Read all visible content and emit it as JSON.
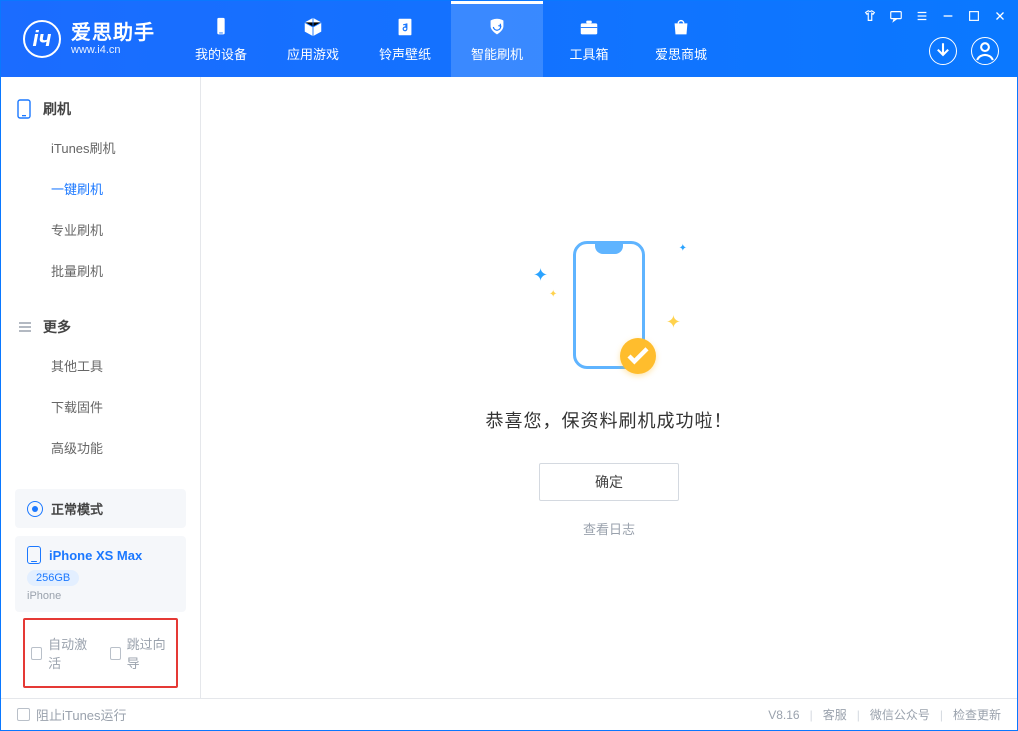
{
  "logo": {
    "cn": "爱思助手",
    "en": "www.i4.cn"
  },
  "nav": {
    "items": [
      {
        "label": "我的设备"
      },
      {
        "label": "应用游戏"
      },
      {
        "label": "铃声壁纸"
      },
      {
        "label": "智能刷机"
      },
      {
        "label": "工具箱"
      },
      {
        "label": "爱思商城"
      }
    ]
  },
  "sidebar": {
    "section1": {
      "title": "刷机",
      "items": [
        {
          "label": "iTunes刷机"
        },
        {
          "label": "一键刷机"
        },
        {
          "label": "专业刷机"
        },
        {
          "label": "批量刷机"
        }
      ]
    },
    "section2": {
      "title": "更多",
      "items": [
        {
          "label": "其他工具"
        },
        {
          "label": "下载固件"
        },
        {
          "label": "高级功能"
        }
      ]
    },
    "mode": {
      "label": "正常模式"
    },
    "device": {
      "name": "iPhone XS Max",
      "badge": "256GB",
      "sub": "iPhone"
    },
    "checks": {
      "auto_activate": "自动激活",
      "skip_guide": "跳过向导"
    }
  },
  "main": {
    "success_text": "恭喜您，保资料刷机成功啦！",
    "ok_label": "确定",
    "view_log": "查看日志"
  },
  "status": {
    "block_itunes": "阻止iTunes运行",
    "version": "V8.16",
    "links": {
      "support": "客服",
      "wechat": "微信公众号",
      "update": "检查更新"
    }
  }
}
